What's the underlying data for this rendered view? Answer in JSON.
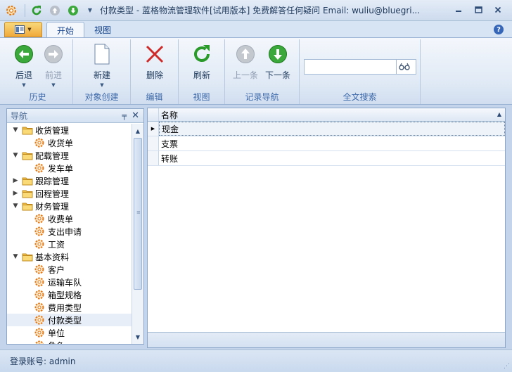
{
  "window": {
    "title": "付款类型 - 蓝格物流管理软件[试用版本] 免费解答任何疑问 Email: wuliu@bluegri...",
    "controls": {
      "minimize": "▭",
      "restore": "▢",
      "close": "✕"
    }
  },
  "tabs": [
    {
      "label": "开始"
    },
    {
      "label": "视图"
    }
  ],
  "help": "?",
  "ribbon": {
    "groups": {
      "history": "历史",
      "object_create": "对象创建",
      "edit": "编辑",
      "view": "视图",
      "record_nav": "记录导航",
      "fulltext": "全文搜索"
    },
    "buttons": {
      "back": "后退",
      "forward": "前进",
      "new": "新建",
      "delete": "删除",
      "refresh": "刷新",
      "prev": "上一条",
      "next": "下一条"
    },
    "search_value": ""
  },
  "nav": {
    "title": "导航",
    "items": [
      {
        "label": "收货管理",
        "level": 0,
        "expanded": true
      },
      {
        "label": "收货单",
        "level": 1
      },
      {
        "label": "配载管理",
        "level": 0,
        "expanded": true
      },
      {
        "label": "发车单",
        "level": 1
      },
      {
        "label": "跟踪管理",
        "level": 0,
        "expanded": false
      },
      {
        "label": "回程管理",
        "level": 0,
        "expanded": false
      },
      {
        "label": "财务管理",
        "level": 0,
        "expanded": true
      },
      {
        "label": "收费单",
        "level": 1
      },
      {
        "label": "支出申请",
        "level": 1
      },
      {
        "label": "工资",
        "level": 1
      },
      {
        "label": "基本资料",
        "level": 0,
        "expanded": true
      },
      {
        "label": "客户",
        "level": 1
      },
      {
        "label": "运输车队",
        "level": 1
      },
      {
        "label": "箱型规格",
        "level": 1
      },
      {
        "label": "费用类型",
        "level": 1
      },
      {
        "label": "付款类型",
        "level": 1,
        "selected": true
      },
      {
        "label": "单位",
        "level": 1
      },
      {
        "label": "角色",
        "level": 1
      }
    ]
  },
  "grid": {
    "column": "名称",
    "rows": [
      "现金",
      "支票",
      "转账"
    ]
  },
  "status": {
    "login": "登录账号: admin"
  }
}
